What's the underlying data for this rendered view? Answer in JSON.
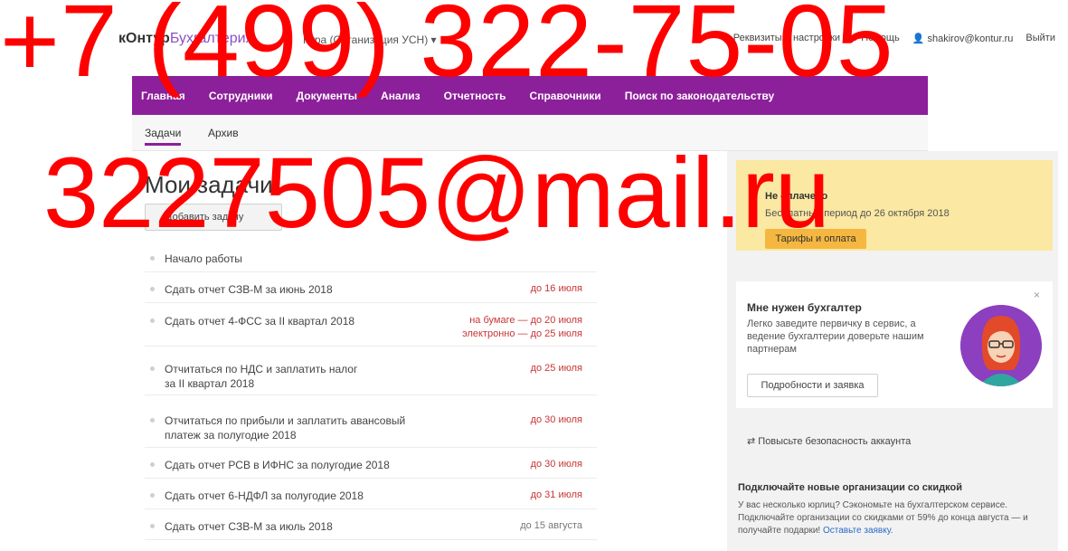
{
  "header": {
    "logo_part1": "кОнтур",
    "logo_part2": "Бухгалтерия",
    "org_selector": "Кура (Организация УСН)",
    "links": [
      "Реквизиты и настройки",
      "Помощь",
      "shakirov@kontur.ru",
      "Выйти"
    ]
  },
  "menu": {
    "items": [
      "Главная",
      "Сотрудники",
      "Документы",
      "Анализ",
      "Отчетность",
      "Справочники",
      "Поиск по законодательству"
    ]
  },
  "tabs": [
    "Задачи",
    "Архив"
  ],
  "main": {
    "title": "Мои задачи",
    "add_button": "Добавить задачу",
    "tasks": [
      {
        "text": "Начало работы",
        "due": ""
      },
      {
        "text": "Сдать отчет СЗВ-М за июнь 2018",
        "due": "до 16 июля"
      },
      {
        "text": "Сдать отчет 4-ФСС за II квартал 2018",
        "due": "на бумаге — до 20 июля",
        "due2": "электронно — до 25 июля"
      },
      {
        "text": "Отчитаться по НДС и заплатить налог",
        "text2": "за II квартал 2018",
        "due": "до 25 июля"
      },
      {
        "text": "Отчитаться по прибыли и заплатить авансовый",
        "text2": "платеж за полугодие 2018",
        "due": "до 30 июля"
      },
      {
        "text": "Сдать отчет РСВ в ИФНС за полугодие 2018",
        "due": "до 30 июля"
      },
      {
        "text": "Сдать отчет 6-НДФЛ за полугодие 2018",
        "due": "до 31 июля"
      },
      {
        "text": "Сдать отчет СЗВ-М за июль 2018",
        "due": "до 15 августа"
      }
    ]
  },
  "sidebar": {
    "notice_title": "Не оплачено",
    "notice_text": "Бесплатный период до 26 октября 2018",
    "tariff_button": "Тарифы и оплата",
    "promo_title": "Мне нужен бухгалтер",
    "promo_text": "Легко заведите первичку в сервис, а ведение бухгалтерии доверьте нашим партнерам",
    "promo_button": "Подробности и заявка",
    "promo_close": "×",
    "security_text": "Повысьте безопасность аккаунта",
    "connect_title": "Подключайте новые организации со скидкой",
    "connect_text": "У вас несколько юрлиц? Сэкономьте на бухгалтерском сервисе. Подключайте организации со скидками от 59% до конца августа — и получайте подарки!",
    "connect_link": "Оставьте заявку."
  },
  "watermark": {
    "phone": "+7 (499) 322-75-05",
    "email": "3227505@mail.ru"
  },
  "colors": {
    "menu_bg": "#8c1f9a",
    "notice_bg": "#fbe8a2",
    "button_yellow": "#f5b740",
    "watermark": "#ff0000",
    "due_red": "#c93535"
  }
}
